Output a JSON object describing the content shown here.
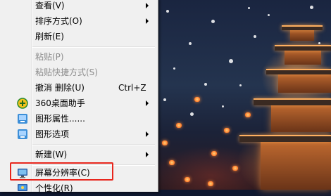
{
  "menu": {
    "items": [
      {
        "label": "查看(V)",
        "has_submenu": true
      },
      {
        "label": "排序方式(O)",
        "has_submenu": true
      },
      {
        "label": "刷新(E)"
      },
      {
        "label": "粘贴(P)",
        "disabled": true
      },
      {
        "label": "粘贴快捷方式(S)",
        "disabled": true
      },
      {
        "label": "撤消 删除(U)",
        "shortcut": "Ctrl+Z"
      },
      {
        "label": "360桌面助手",
        "has_submenu": true,
        "icon": "360-assistant-icon"
      },
      {
        "label": "图形属性......",
        "icon": "graphics-properties-icon"
      },
      {
        "label": "图形选项",
        "has_submenu": true,
        "icon": "graphics-options-icon"
      },
      {
        "label": "新建(W)",
        "has_submenu": true
      },
      {
        "label": "屏幕分辨率(C)",
        "icon": "screen-resolution-icon",
        "highlighted": true
      },
      {
        "label": "个性化(R)",
        "icon": "personalize-icon"
      }
    ]
  },
  "colors": {
    "menu_bg": "#f0f0f0",
    "highlight_border": "#e8261d",
    "disabled_text": "#8d8d8d"
  }
}
